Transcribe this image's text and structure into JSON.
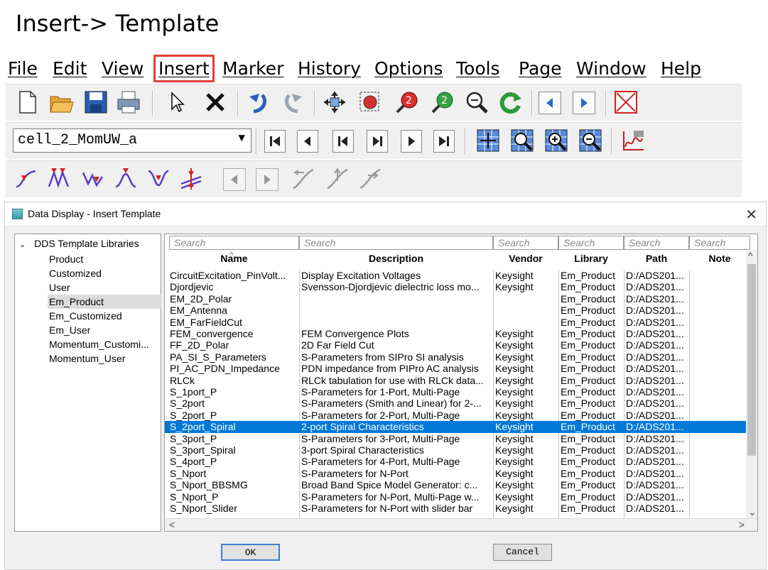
{
  "slide_title": "Insert-> Template",
  "menu": [
    "File",
    "Edit",
    "View",
    "Insert",
    "Marker",
    "History",
    "Options",
    "Tools",
    "Page",
    "Window",
    "Help"
  ],
  "cell_selector": {
    "value": "cell_2_MomUW_a"
  },
  "dialog": {
    "title": "Data Display - Insert Template",
    "tree": {
      "root": "DDS Template Libraries",
      "items": [
        "Product",
        "Customized",
        "User",
        "Em_Product",
        "Em_Customized",
        "Em_User",
        "Momentum_Customi...",
        "Momentum_User"
      ],
      "selected": "Em_Product"
    },
    "search_placeholder": "Search",
    "columns": [
      "Name",
      "Description",
      "Vendor",
      "Library",
      "Path",
      "Note"
    ],
    "rows": [
      [
        "CircuitExcitation_PinVolt...",
        "Display Excitation Voltages",
        "Keysight",
        "Em_Product",
        "D:/ADS201...",
        ""
      ],
      [
        "Djordjevic",
        "Svensson-Djordjevic dielectric loss mo...",
        "Keysight",
        "Em_Product",
        "D:/ADS201...",
        ""
      ],
      [
        "EM_2D_Polar",
        "",
        "",
        "Em_Product",
        "D:/ADS201...",
        ""
      ],
      [
        "EM_Antenna",
        "",
        "",
        "Em_Product",
        "D:/ADS201...",
        ""
      ],
      [
        "EM_FarFieldCut",
        "",
        "",
        "Em_Product",
        "D:/ADS201...",
        ""
      ],
      [
        "FEM_convergence",
        "FEM Convergence Plots",
        "Keysight",
        "Em_Product",
        "D:/ADS201...",
        ""
      ],
      [
        "FF_2D_Polar",
        "2D Far Field Cut",
        "Keysight",
        "Em_Product",
        "D:/ADS201...",
        ""
      ],
      [
        "PA_SI_S_Parameters",
        "S-Parameters from SIPro SI analysis",
        "Keysight",
        "Em_Product",
        "D:/ADS201...",
        ""
      ],
      [
        "PI_AC_PDN_Impedance",
        "PDN impedance from PIPro AC analysis",
        "Keysight",
        "Em_Product",
        "D:/ADS201...",
        ""
      ],
      [
        "RLCk",
        "RLCk tabulation for use with RLCk data...",
        "Keysight",
        "Em_Product",
        "D:/ADS201...",
        ""
      ],
      [
        "S_1port_P",
        "S-Parameters for 1-Port, Multi-Page",
        "Keysight",
        "Em_Product",
        "D:/ADS201...",
        ""
      ],
      [
        "S_2port",
        "S-Parameters (Smith and Linear) for 2-...",
        "Keysight",
        "Em_Product",
        "D:/ADS201...",
        ""
      ],
      [
        "S_2port_P",
        "S-Parameters for 2-Port, Multi-Page",
        "Keysight",
        "Em_Product",
        "D:/ADS201...",
        ""
      ],
      [
        "S_2port_Spiral",
        "2-port Spiral Characteristics",
        "Keysight",
        "Em_Product",
        "D:/ADS201...",
        ""
      ],
      [
        "S_3port_P",
        "S-Parameters for 3-Port, Multi-Page",
        "Keysight",
        "Em_Product",
        "D:/ADS201...",
        ""
      ],
      [
        "S_3port_Spiral",
        "3-port Spiral Characteristics",
        "Keysight",
        "Em_Product",
        "D:/ADS201...",
        ""
      ],
      [
        "S_4port_P",
        "S-Parameters for 4-Port, Multi-Page",
        "Keysight",
        "Em_Product",
        "D:/ADS201...",
        ""
      ],
      [
        "S_Nport",
        "S-Parameters for N-Port",
        "Keysight",
        "Em_Product",
        "D:/ADS201...",
        ""
      ],
      [
        "S_Nport_BBSMG",
        "Broad Band Spice Model Generator: c...",
        "Keysight",
        "Em_Product",
        "D:/ADS201...",
        ""
      ],
      [
        "S_Nport_P",
        "S-Parameters for N-Port, Multi-Page w...",
        "Keysight",
        "Em_Product",
        "D:/ADS201...",
        ""
      ],
      [
        "S_Nport_Slider",
        "S-Parameters for N-Port with slider bar",
        "Keysight",
        "Em_Product",
        "D:/ADS201...",
        ""
      ]
    ],
    "selected_row": 13,
    "ok_label": "OK",
    "cancel_label": "Cancel"
  },
  "colors": {
    "selection": "#0078d7",
    "highlight_box": "#e0403a",
    "marker_red": "#d42020",
    "marker_blue": "#5a3ec8"
  }
}
